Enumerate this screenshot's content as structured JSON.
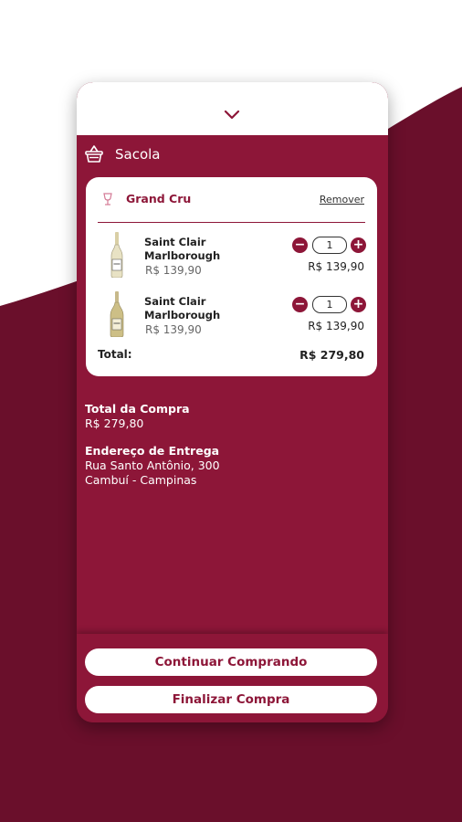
{
  "header": {
    "title": "Sacola"
  },
  "cart": {
    "store_name": "Grand Cru",
    "remove_label": "Remover",
    "items": [
      {
        "name_line1": "Saint Clair",
        "name_line2": "Marlborough",
        "price": "R$ 139,90",
        "quantity": "1",
        "subtotal": "R$ 139,90"
      },
      {
        "name_line1": "Saint Clair",
        "name_line2": "Marlborough",
        "price": "R$ 139,90",
        "quantity": "1",
        "subtotal": "R$ 139,90"
      }
    ],
    "total_label": "Total:",
    "total_value": "R$ 279,80"
  },
  "summary": {
    "purchase_total_label": "Total da Compra",
    "purchase_total_value": "R$ 279,80",
    "address_label": "Endereço de Entrega",
    "address_line1": "Rua Santo Antônio, 300",
    "address_line2": "Cambuí - Campinas"
  },
  "actions": {
    "continue_label": "Continuar Comprando",
    "finalize_label": "Finalizar Compra"
  },
  "icons": {
    "chevron": "chevron-down-icon",
    "basket": "basket-icon",
    "store": "wine-glass-icon",
    "minus": "minus-icon",
    "plus": "plus-icon"
  },
  "colors": {
    "brand": "#8d1638",
    "brand_dark": "#6a0f2b",
    "surface": "#ffffff"
  }
}
